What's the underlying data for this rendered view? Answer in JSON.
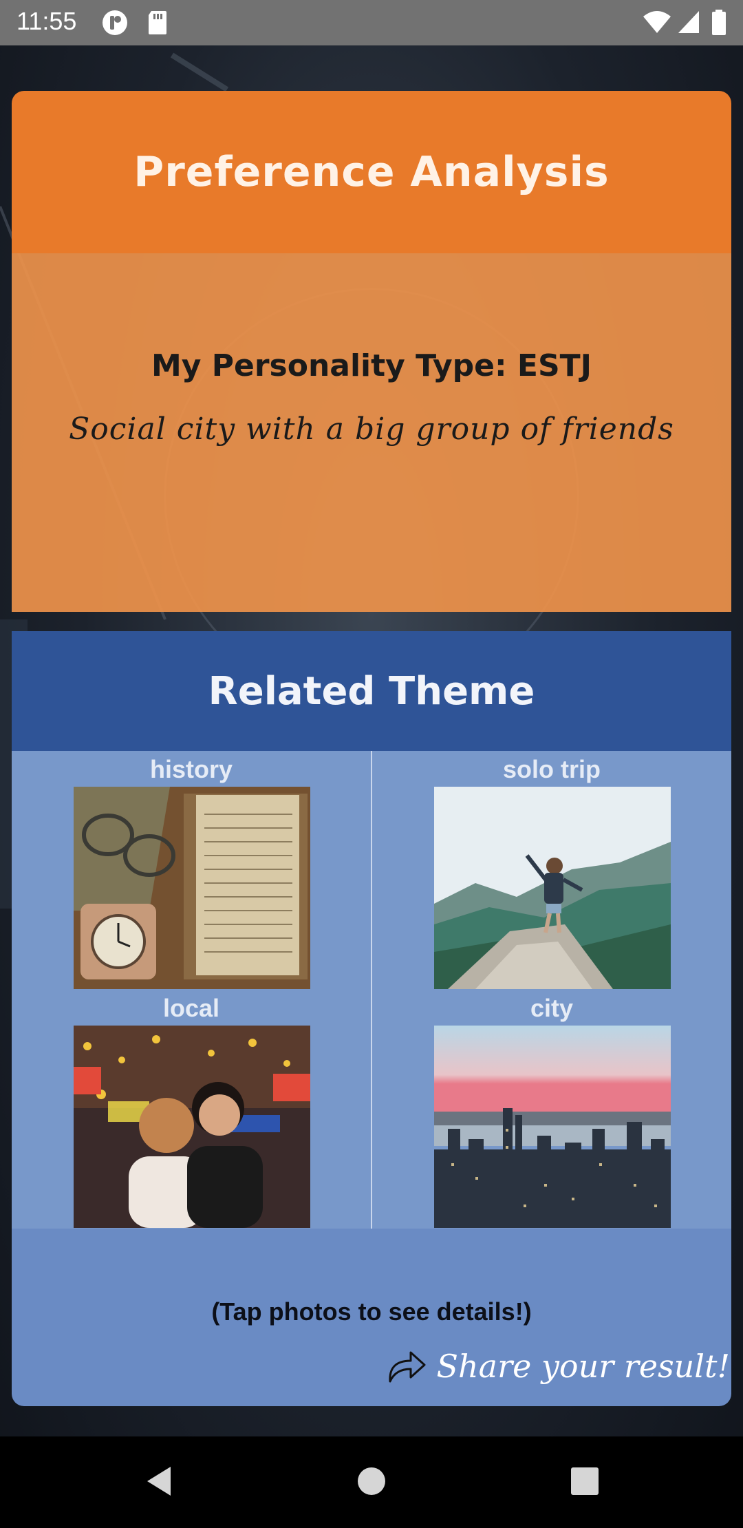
{
  "status_bar": {
    "time": "11:55",
    "icons": [
      "app-notification-icon",
      "sd-card-icon",
      "wifi-icon",
      "signal-icon",
      "battery-icon"
    ]
  },
  "preference": {
    "title": "Preference Analysis",
    "personality_type": "My Personality Type: ESTJ",
    "description": "Social city with a big group of friends",
    "header_color": "#e87a2a",
    "body_color": "#ee924b"
  },
  "related_theme": {
    "title": "Related Theme",
    "items": [
      {
        "label": "history",
        "image": "old-book-glasses-clock-photo"
      },
      {
        "label": "solo trip",
        "image": "hiker-mountain-photo"
      },
      {
        "label": "local",
        "image": "night-market-friends-photo"
      },
      {
        "label": "city",
        "image": "city-skyline-photo"
      }
    ],
    "hint": "(Tap photos to see details!)",
    "share_label": "Share your result!",
    "header_color": "#2f5497",
    "grid_color": "#7898ca"
  },
  "nav_bar": {
    "buttons": [
      "back",
      "home",
      "recents"
    ]
  }
}
